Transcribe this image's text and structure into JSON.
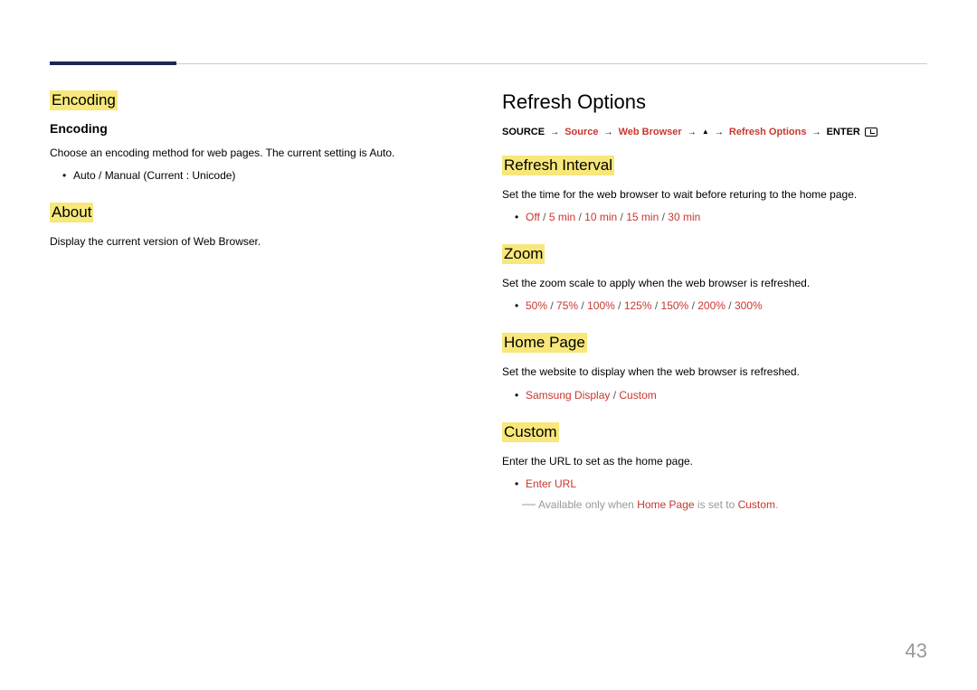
{
  "pageNumber": "43",
  "left": {
    "encoding": {
      "heading": "Encoding",
      "subheading": "Encoding",
      "desc": "Choose an encoding method for web pages. The current setting is Auto.",
      "bullet": "Auto / Manual (Current : Unicode)"
    },
    "about": {
      "heading": "About",
      "desc": "Display the current version of Web Browser."
    }
  },
  "right": {
    "title": "Refresh Options",
    "breadcrumb": {
      "p1": "SOURCE",
      "p2": "Source",
      "p3": "Web Browser",
      "p4": "Refresh Options",
      "p5": "ENTER"
    },
    "refreshInterval": {
      "heading": "Refresh Interval",
      "desc": "Set the time for the web browser to wait before returing to the home page.",
      "options": [
        "Off",
        "5 min",
        "10 min",
        "15 min",
        "30 min"
      ]
    },
    "zoom": {
      "heading": "Zoom",
      "desc": "Set the zoom scale to apply when the web browser is refreshed.",
      "options": [
        "50%",
        "75%",
        "100%",
        "125%",
        "150%",
        "200%",
        "300%"
      ]
    },
    "homePage": {
      "heading": "Home Page",
      "desc": "Set the website to display when the web browser is refreshed.",
      "options": [
        "Samsung Display",
        "Custom"
      ]
    },
    "custom": {
      "heading": "Custom",
      "desc": "Enter the URL to set as the home page.",
      "option": "Enter URL",
      "notePrefix": "Available only when ",
      "noteStrong1": "Home Page",
      "noteMid": " is set to ",
      "noteStrong2": "Custom",
      "noteSuffix": "."
    }
  }
}
